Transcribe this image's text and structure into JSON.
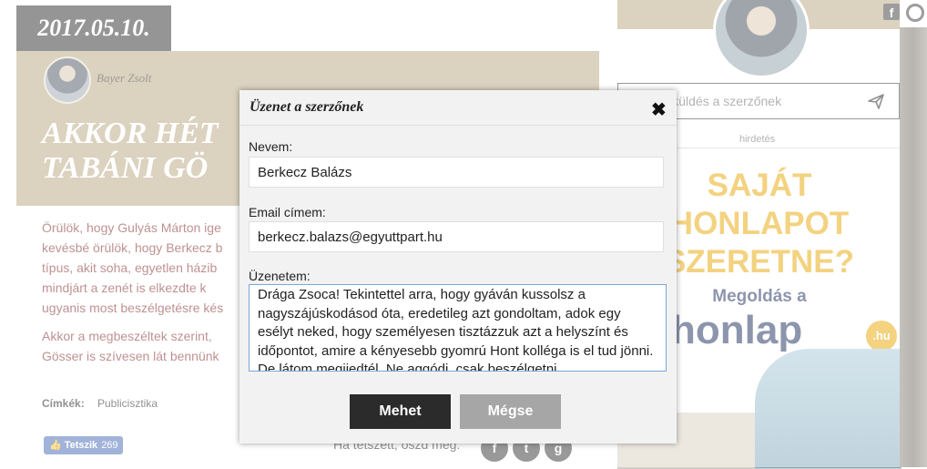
{
  "article": {
    "date": "2017.05.10.",
    "author": "Bayer Zsolt",
    "headline_line1": "AKKOR HÉT",
    "headline_line2": "TABÁNI GÖ",
    "paragraph1": [
      "Örülök, hogy Gulyás Márton ige",
      "kevésbé örülök, hogy Berkecz b",
      "típus, akit soha, egyetlen házib",
      "mindjárt a zenét is elkezdte k",
      "ugyanis most beszélgetésre kés"
    ],
    "paragraph2": [
      "Akkor a megbeszéltek szerint,",
      "Gösser is szívesen lát bennünk"
    ],
    "tags_label": "Címkék:",
    "tags_value": "Publicisztika",
    "like_label": "Tetszik",
    "like_count": "269",
    "share_text": "Ha tetszett, oszd meg:"
  },
  "sidebar": {
    "message_placeholder": "Üzenet küldés a szerzőnek",
    "ad_label": "hirdetés",
    "ad_lines": [
      "SAJÁT",
      "HONLAPOT",
      "SZERETNE?"
    ],
    "ad_solution": "Megoldás a",
    "ad_logo": "honlap",
    "ad_logo_suffix": ".hu"
  },
  "modal": {
    "title": "Üzenet a szerzőnek",
    "close_symbol": "✖",
    "name_label": "Nevem:",
    "name_value": "Berkecz Balázs",
    "email_label": "Email címem:",
    "email_value": "berkecz.balazs@egyuttpart.hu",
    "message_label": "Üzenetem:",
    "message_value": "Drága Zsoca! Tekintettel arra, hogy gyáván kussolsz a nagyszájúskodásod óta, eredetileg azt gondoltam, adok egy esélyt neked, hogy személyesen tisztázzuk azt a helyszínt és időpontot, amire a kényesebb gyomrú Hont kolléga is el tud jönni. De látom megijedtél. Ne aggódj, csak beszélgetni",
    "submit_label": "Mehet",
    "cancel_label": "Mégse"
  }
}
